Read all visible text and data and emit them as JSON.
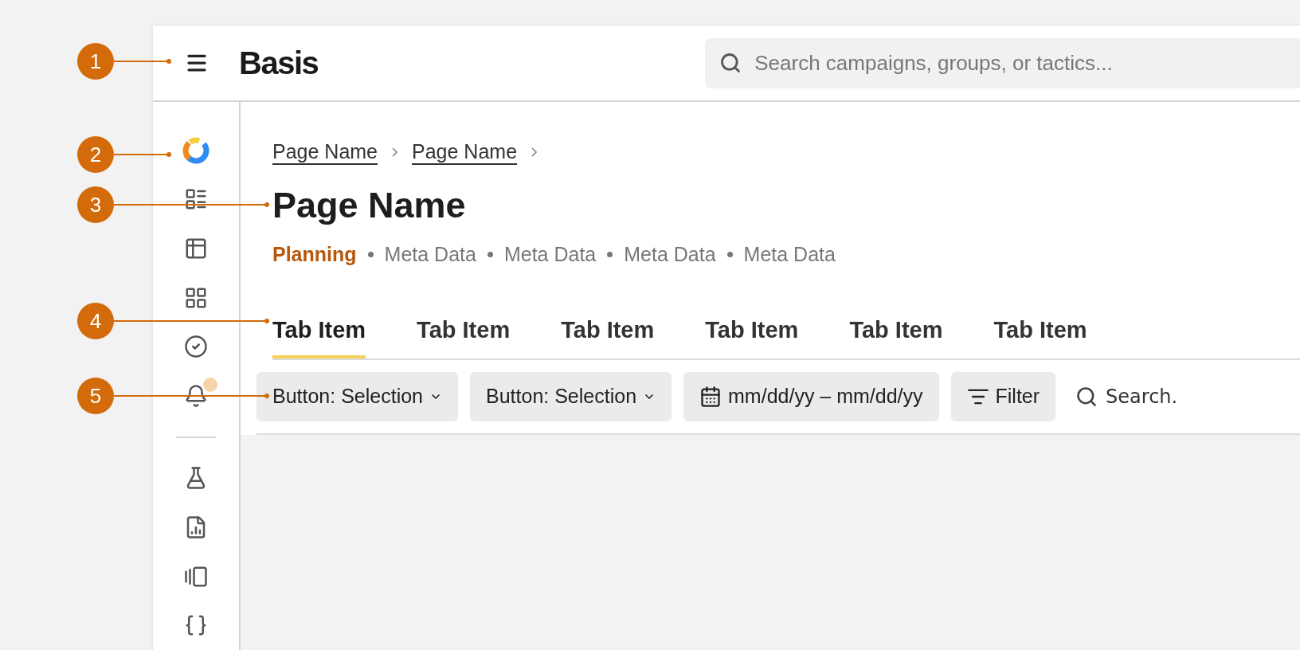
{
  "header": {
    "logo": "Basis",
    "search": {
      "placeholder": "Search campaigns, groups, or tactics..."
    }
  },
  "sidebar": {
    "items": [
      {
        "kind": "brand",
        "notification": false
      },
      {
        "kind": "list",
        "notification": false
      },
      {
        "kind": "table",
        "notification": false
      },
      {
        "kind": "grid",
        "notification": false
      },
      {
        "kind": "check",
        "notification": false
      },
      {
        "kind": "bell",
        "notification": true
      },
      {
        "kind": "divider",
        "notification": false
      },
      {
        "kind": "flask",
        "notification": false
      },
      {
        "kind": "report",
        "notification": false
      },
      {
        "kind": "carousel",
        "notification": false
      },
      {
        "kind": "braces",
        "notification": false
      }
    ]
  },
  "breadcrumb": [
    "Page Name",
    "Page Name"
  ],
  "title": "Page Name",
  "status": "Planning",
  "meta": [
    "Meta Data",
    "Meta Data",
    "Meta Data",
    "Meta Data"
  ],
  "tabs": [
    {
      "label": "Tab Item",
      "selected": true
    },
    {
      "label": "Tab Item",
      "selected": false
    },
    {
      "label": "Tab Item",
      "selected": false
    },
    {
      "label": "Tab Item",
      "selected": false
    },
    {
      "label": "Tab Item",
      "selected": false
    },
    {
      "label": "Tab Item",
      "selected": false
    }
  ],
  "toolbar": [
    {
      "kind": "select",
      "label": "Button: Selection"
    },
    {
      "kind": "select",
      "label": "Button: Selection"
    },
    {
      "kind": "date",
      "label": "mm/dd/yy – mm/dd/yy"
    },
    {
      "kind": "filter",
      "label": "Filter"
    },
    {
      "kind": "search",
      "placeholder": "Search."
    }
  ],
  "callouts": [
    "1",
    "2",
    "3",
    "4",
    "5"
  ]
}
